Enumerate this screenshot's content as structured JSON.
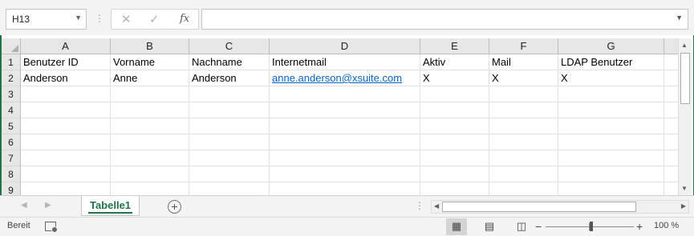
{
  "formula_bar": {
    "name_box": "H13",
    "cancel_glyph": "✕",
    "enter_glyph": "✓",
    "function_glyph": "fx",
    "formula": ""
  },
  "columns": [
    "A",
    "B",
    "C",
    "D",
    "E",
    "F",
    "G"
  ],
  "rows": [
    "1",
    "2",
    "3",
    "4",
    "5",
    "6",
    "7",
    "8",
    "9"
  ],
  "cells": {
    "header": [
      "Benutzer ID",
      "Vorname",
      "Nachname",
      "Internetmail",
      "Aktiv",
      "Mail",
      "LDAP Benutzer"
    ],
    "data": [
      "Anderson",
      "Anne",
      "Anderson",
      "anne.anderson@xsuite.com",
      "X",
      "X",
      "X"
    ]
  },
  "sheet_tabs": {
    "active": "Tabelle1",
    "add_glyph": "+"
  },
  "status_bar": {
    "status": "Bereit",
    "zoom_minus": "−",
    "zoom_plus": "+",
    "zoom": "100 %"
  },
  "colors": {
    "excel_green": "#217346",
    "link_blue": "#0563c1"
  },
  "icons": [
    "dropdown-arrow-icon",
    "cancel-icon",
    "enter-icon",
    "function-icon",
    "add-sheet-icon",
    "macro-record-icon",
    "normal-view-icon",
    "page-layout-view-icon",
    "page-break-view-icon"
  ]
}
